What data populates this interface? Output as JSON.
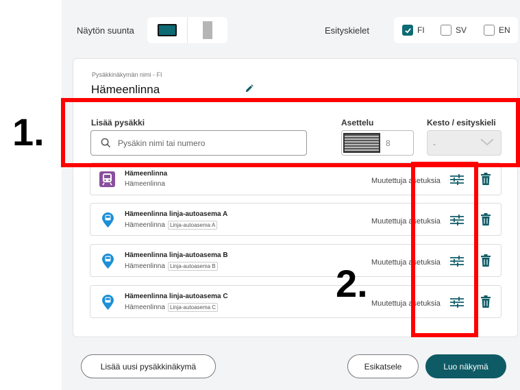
{
  "display_orientation": {
    "label": "Näytön suunta",
    "selected": "landscape"
  },
  "presentation_languages": {
    "label": "Esityskielet",
    "options": [
      {
        "code": "FI",
        "checked": true
      },
      {
        "code": "SV",
        "checked": false
      },
      {
        "code": "EN",
        "checked": false
      }
    ]
  },
  "stop_view": {
    "name_caption": "Pysäkkinäkymän nimi - FI",
    "name": "Hämeenlinna"
  },
  "add_stop": {
    "label": "Lisää pysäkki",
    "placeholder": "Pysäkin nimi tai numero"
  },
  "layout": {
    "label": "Asettelu",
    "value": "8"
  },
  "duration": {
    "label": "Kesto / esityskieli",
    "value": "-"
  },
  "stops": [
    {
      "name": "Hämeenlinna",
      "sub": "Hämeenlinna",
      "tag": "",
      "icon": "train-icon",
      "note": "Muutettuja asetuksia"
    },
    {
      "name": "Hämeenlinna linja-autoasema A",
      "sub": "Hämeenlinna",
      "tag": "Linja-autoasema A",
      "icon": "bus-stop-icon",
      "note": "Muutettuja asetuksia"
    },
    {
      "name": "Hämeenlinna linja-autoasema B",
      "sub": "Hämeenlinna",
      "tag": "Linja-autoasema B",
      "icon": "bus-stop-icon",
      "note": "Muutettuja asetuksia"
    },
    {
      "name": "Hämeenlinna linja-autoasema C",
      "sub": "Hämeenlinna",
      "tag": "Linja-autoasema C",
      "icon": "bus-stop-icon",
      "note": "Muutettuja asetuksia"
    }
  ],
  "footer": {
    "add_view": "Lisää uusi pysäkkinäkymä",
    "preview": "Esikatsele",
    "create": "Luo näkymä"
  },
  "annotations": [
    "1.",
    "2."
  ],
  "colors": {
    "accent": "#0e6a73",
    "primary_button": "#0e5b66",
    "annotation": "#ff0000",
    "train_badge": "#8a4f9e",
    "bus_pin": "#1c8fd6"
  }
}
